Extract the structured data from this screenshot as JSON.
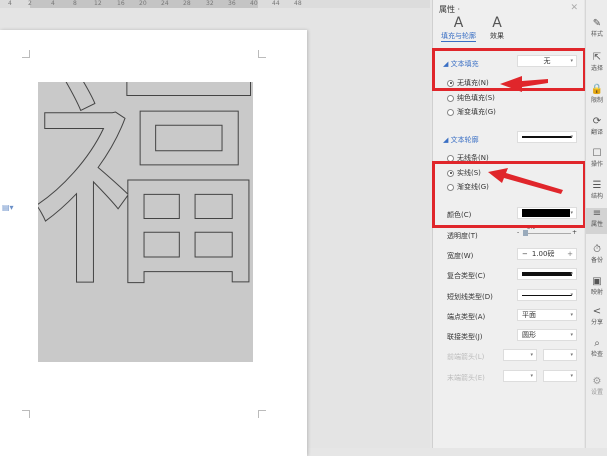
{
  "ruler": {
    "ticks": [
      "4",
      "2",
      "4",
      "8",
      "12",
      "16",
      "20",
      "24",
      "28",
      "32",
      "36",
      "40",
      "44",
      "48"
    ]
  },
  "document": {
    "glyph": "福"
  },
  "panel": {
    "title": "属性 ·",
    "close": "✕",
    "tabs": [
      {
        "label": "填充与轮廓",
        "icon": "A",
        "active": true
      },
      {
        "label": "效果",
        "icon": "A",
        "active": false
      }
    ],
    "text_fill": {
      "header": "文本填充",
      "value": "无",
      "options": [
        {
          "label": "无填充(N)",
          "checked": true
        },
        {
          "label": "纯色填充(S)",
          "checked": false
        },
        {
          "label": "渐变填充(G)",
          "checked": false
        }
      ]
    },
    "text_outline": {
      "header": "文本轮廓",
      "options": [
        {
          "label": "无线条(N)",
          "checked": false
        },
        {
          "label": "实线(S)",
          "checked": true
        },
        {
          "label": "渐变线(G)",
          "checked": false
        }
      ]
    },
    "color": {
      "label": "颜色(C)",
      "value": "#000000"
    },
    "transparency": {
      "label": "透明度(T)",
      "value": "0%",
      "minus": "-",
      "plus": "+"
    },
    "width": {
      "label": "宽度(W)",
      "value": "1.00磅",
      "minus": "−",
      "plus": "+"
    },
    "compound": {
      "label": "复合类型(C)"
    },
    "dash": {
      "label": "短划线类型(D)"
    },
    "cap": {
      "label": "端点类型(A)",
      "value": "平面"
    },
    "join": {
      "label": "联接类型(J)",
      "value": "圆形"
    },
    "begin_arrow": {
      "label": "前端箭头(L)"
    },
    "end_arrow": {
      "label": "末端箭头(E)"
    }
  },
  "rail": [
    {
      "label": "样式",
      "icon": "✎"
    },
    {
      "label": "选择",
      "icon": "⇱"
    },
    {
      "label": "限制",
      "icon": "🔒"
    },
    {
      "label": "翻译",
      "icon": "⟳"
    },
    {
      "label": "操作",
      "icon": "☐"
    },
    {
      "label": "结构",
      "icon": "☰"
    },
    {
      "label": "属性",
      "icon": "≡",
      "active": true
    },
    {
      "label": "备份",
      "icon": "⏱"
    },
    {
      "label": "映射",
      "icon": "▣"
    },
    {
      "label": "分享",
      "icon": "<"
    },
    {
      "label": "检查",
      "icon": "⌕"
    },
    {
      "label": "设置",
      "icon": "⚙"
    }
  ],
  "colors": {
    "accent": "#3a6fc4",
    "highlight": "#e0262b"
  }
}
